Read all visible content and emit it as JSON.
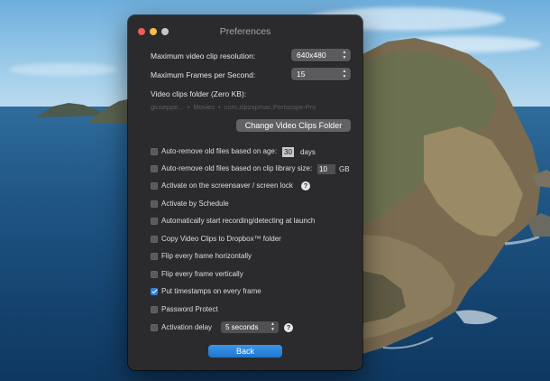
{
  "window": {
    "title": "Preferences"
  },
  "settings": {
    "max_resolution_label": "Maximum video clip resolution:",
    "max_resolution_value": "640x480",
    "max_fps_label": "Maximum Frames per Second:",
    "max_fps_value": "15",
    "folder_label": "Video clips folder (Zero KB):",
    "folder_path": [
      "giuseppe...",
      "Movies",
      "com.zipzapmac.Periscope-Pro"
    ],
    "change_folder_button": "Change Video Clips Folder"
  },
  "options": [
    {
      "label": "Auto-remove old files based on age:",
      "checked": false
    },
    {
      "label": "Auto-remove old files based on clip library size:",
      "checked": false
    },
    {
      "label": "Activate on the screensaver / screen lock",
      "checked": false
    },
    {
      "label": "Activate by Schedule",
      "checked": false
    },
    {
      "label": "Automatically start recording/detecting at launch",
      "checked": false
    },
    {
      "label": "Copy Video Clips to Dropbox™ folder",
      "checked": false
    },
    {
      "label": "Flip every frame horizontally",
      "checked": false
    },
    {
      "label": "Flip every frame vertically",
      "checked": false
    },
    {
      "label": "Put timestamps on every frame",
      "checked": true
    },
    {
      "label": "Password Protect",
      "checked": false
    },
    {
      "label": "Activation delay",
      "checked": false
    }
  ],
  "age_input": {
    "value": "30",
    "suffix": "days"
  },
  "size_input": {
    "value": "10",
    "suffix": "GB"
  },
  "activation_delay": {
    "value": "5 seconds"
  },
  "help_glyph": "?",
  "back_button": "Back",
  "popup_arrows": {
    "up": "▲",
    "down": "▼"
  },
  "colors": {
    "window_bg": "#2b2b2d",
    "accent": "#2f82e0",
    "close": "#ee5c55",
    "minimize": "#f4be4f",
    "zoom": "#c6c6c6"
  }
}
